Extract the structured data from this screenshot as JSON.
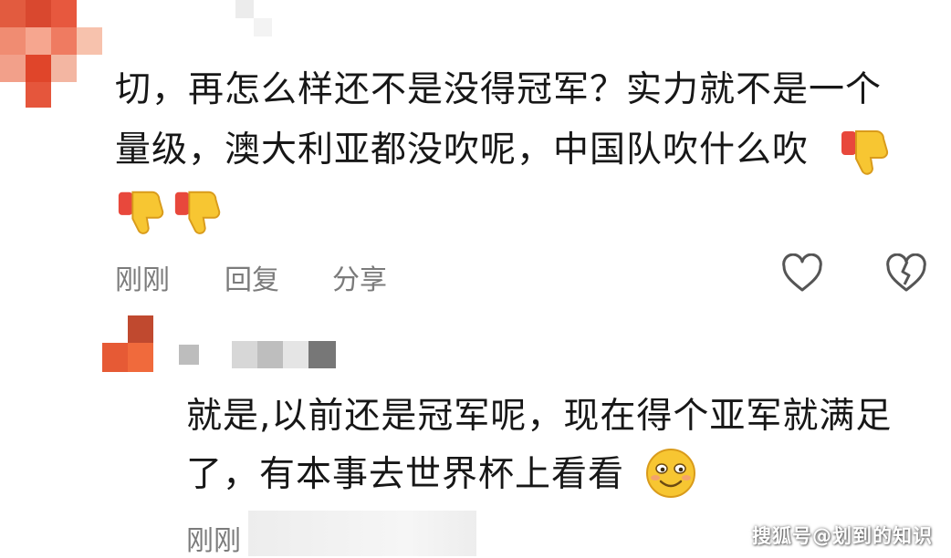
{
  "comment1": {
    "text_line1": "切，再怎么样还不是没得冠军？实力就不是一个",
    "text_line2": "量级，澳大利亚都没吹呢，中国队吹什么吹",
    "emojis": [
      "thumbs-down-icon",
      "thumbs-down-icon",
      "thumbs-down-icon"
    ],
    "time": "刚刚",
    "reply_label": "回复",
    "share_label": "分享",
    "like_icon": "heart-outline-icon",
    "dislike_icon": "broken-heart-icon"
  },
  "comment2": {
    "text_line1": "就是,以前还是冠军呢，现在得个亚军就满足",
    "text_line2": "了，有本事去世界杯上看看",
    "emoji": "smiling-face-icon",
    "time": "刚刚"
  },
  "watermark": "搜狐号@划到的知识",
  "colors": {
    "text": "#171717",
    "meta": "#7b7b7b",
    "emoji_yellow": "#f7c632",
    "emoji_red": "#e8483c",
    "avatar_red": "#e0452a"
  }
}
